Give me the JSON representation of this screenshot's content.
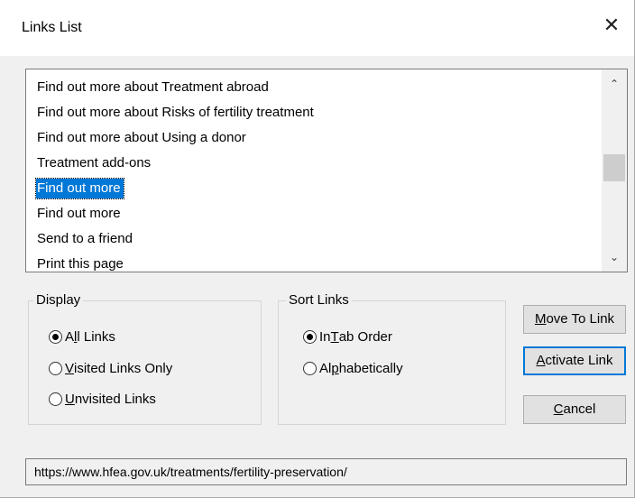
{
  "window": {
    "title": "Links List",
    "close_glyph": "✕"
  },
  "links": [
    {
      "label": "Find out more about Treatment abroad",
      "selected": false
    },
    {
      "label": "Find out more about Risks of fertility treatment",
      "selected": false
    },
    {
      "label": "Find out more about Using a donor",
      "selected": false
    },
    {
      "label": "Treatment add-ons",
      "selected": false
    },
    {
      "label": "Find out more",
      "selected": true
    },
    {
      "label": "Find out more",
      "selected": false
    },
    {
      "label": "Send to a friend",
      "selected": false
    },
    {
      "label": "Print this page",
      "selected": false
    }
  ],
  "scrollbar": {
    "up_glyph": "⌃",
    "down_glyph": "⌄"
  },
  "display": {
    "label": "Display",
    "options": [
      {
        "pre": "A",
        "key": "l",
        "post": "l Links",
        "checked": true
      },
      {
        "pre": "",
        "key": "V",
        "post": "isited Links Only",
        "checked": false
      },
      {
        "pre": "",
        "key": "U",
        "post": "nvisited Links",
        "checked": false
      }
    ]
  },
  "sort": {
    "label": "Sort Links",
    "options": [
      {
        "pre": "In ",
        "key": "T",
        "post": "ab Order",
        "checked": true
      },
      {
        "pre": "Al",
        "key": "p",
        "post": "habetically",
        "checked": false
      }
    ]
  },
  "buttons": {
    "move": {
      "key": "M",
      "rest": "ove To Link"
    },
    "activate": {
      "key": "A",
      "rest": "ctivate Link"
    },
    "cancel": {
      "key": "C",
      "rest": "ancel"
    }
  },
  "url": "https://www.hfea.gov.uk/treatments/fertility-preservation/",
  "colors": {
    "selection": "#0078d7",
    "default_button_border": "#0078d7"
  }
}
